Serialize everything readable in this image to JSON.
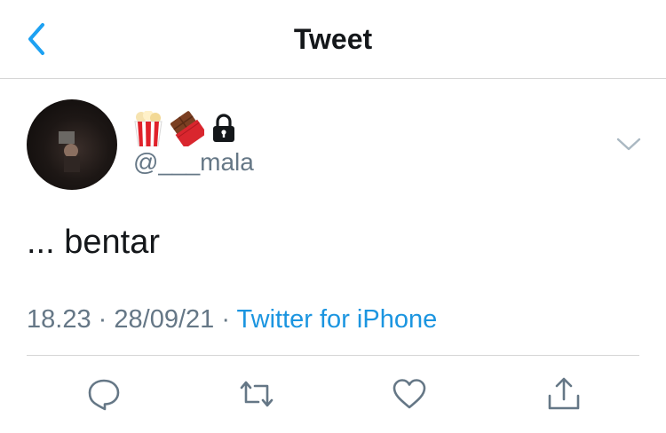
{
  "header": {
    "title": "Tweet",
    "back_icon": "chevron-left-icon",
    "accent": "#1da1f2"
  },
  "tweet": {
    "author": {
      "display_emojis": [
        "popcorn-icon",
        "chocolate-bar-icon",
        "lock-icon"
      ],
      "handle": "@___mala",
      "protected": true
    },
    "text": "... bentar",
    "time": "18.23",
    "date": "28/09/21",
    "separator": "·",
    "source": "Twitter for iPhone",
    "link_color": "#1b95e0"
  },
  "actions": [
    "reply-icon",
    "retweet-icon",
    "like-icon",
    "share-icon"
  ]
}
